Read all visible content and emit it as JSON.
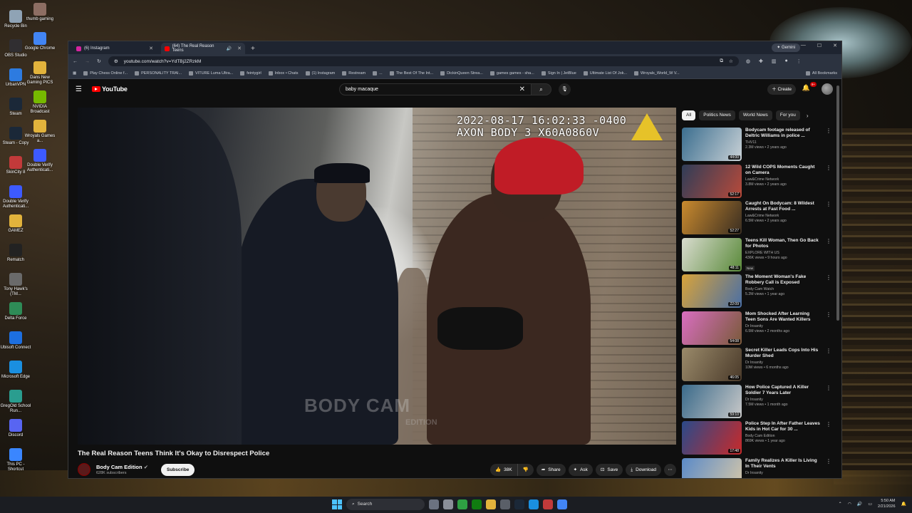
{
  "desktop": {
    "icons": [
      {
        "label": "Recycle Bin",
        "color": "#8fa3b5"
      },
      {
        "label": "OBS Studio",
        "color": "#302e31"
      },
      {
        "label": "UrbanVPN",
        "color": "#2d7be0"
      },
      {
        "label": "Steam",
        "color": "#1b2838"
      },
      {
        "label": "Steam - Copy",
        "color": "#1b2838"
      },
      {
        "label": "SkinCity 8",
        "color": "#c23a3a"
      },
      {
        "label": "Double Verify Authenticati...",
        "color": "#3d5afe"
      },
      {
        "label": "GAMEZ",
        "color": "#e2b33c"
      },
      {
        "label": "Rematch",
        "color": "#222"
      },
      {
        "label": "Tony Hawk's (TM...",
        "color": "#6a6a6a"
      },
      {
        "label": "Delta Force",
        "color": "#2e8b57"
      },
      {
        "label": "Ubisoft Connect",
        "color": "#1d6fe0"
      },
      {
        "label": "Microsoft Edge",
        "color": "#1a8fe0"
      },
      {
        "label": "GregOld School Run...",
        "color": "#2a9d8f"
      },
      {
        "label": "Discord",
        "color": "#5865f2"
      },
      {
        "label": "This PC - Shortcut",
        "color": "#3a86ff"
      }
    ],
    "icons_col2": [
      {
        "label": "thumb gaming",
        "color": "#8d6e63"
      },
      {
        "label": "Google Chrome",
        "color": "#4285f4"
      },
      {
        "label": "Dans New Gaming PICS",
        "color": "#e2b33c"
      },
      {
        "label": "NVIDIA Broadcast",
        "color": "#76b900"
      },
      {
        "label": "Wroyals Games a...",
        "color": "#e2b33c"
      },
      {
        "label": "Double Verify Authenticati...",
        "color": "#3d5afe"
      }
    ]
  },
  "browser": {
    "tabs": [
      {
        "label": "(6) Instagram",
        "fav_color": "#d6249f",
        "active": false
      },
      {
        "label": "(64) The Real Reason Teens",
        "fav_color": "#ff0000",
        "active": true
      }
    ],
    "new_tab": "+",
    "gemini_label": "Gemini",
    "url": "youtube.com/watch?v=YdTBj2ZRzkM",
    "bookmarks": [
      "Play Chess Online f...",
      "PERSONALITY TRAI...",
      "VITURE Luma Ultra...",
      "feintygirl",
      "Inbox • Chats",
      "(1) Instagram",
      "Restream",
      "...",
      "The Best Of The Int...",
      "DickinQueen Strea...",
      "games games - sha...",
      "Sign In | JetBlue",
      "Ultimate List Of Jok...",
      "Wroyals_World_W V...",
      "All Bookmarks"
    ]
  },
  "youtube": {
    "logo_text": "YouTube",
    "search_value": "baby macaque",
    "create_label": "Create",
    "notif_badge": "9+",
    "video": {
      "timestamp_line1": "2022-08-17 16:02:33 -0400",
      "timestamp_line2": "AXON BODY 3 X60A0860V",
      "watermark": "BODY CAM",
      "watermark_sub": "EDITION",
      "title": "The Real Reason Teens Think It's Okay to Disrespect Police",
      "channel": "Body Cam Edition",
      "subscribers": "628K subscribers",
      "subscribe_label": "Subscribe",
      "likes": "38K",
      "share_label": "Share",
      "ask_label": "Ask",
      "save_label": "Save",
      "download_label": "Download"
    },
    "chips": [
      "All",
      "Politics News",
      "World News",
      "For you"
    ],
    "recommendations": [
      {
        "title": "Bodycam footage released of Deltric Williams in police ...",
        "channel": "THV11",
        "views": "2.3M views • 2 years ago",
        "duration": "44:00",
        "colors": [
          "#3b6e8f",
          "#c9d1d6"
        ]
      },
      {
        "title": "12 Wild COPS Moments Caught on Camera",
        "channel": "Law&Crime Network",
        "views": "3.8M views • 2 years ago",
        "duration": "52:17",
        "colors": [
          "#2f3d58",
          "#b84a3a"
        ]
      },
      {
        "title": "Caught On Bodycam: 8 Wildest Arrests at Fast Food ...",
        "channel": "Law&Crime Network",
        "views": "6.5M views • 2 years ago",
        "duration": "52:27",
        "colors": [
          "#c98a2e",
          "#3a2e22"
        ]
      },
      {
        "title": "Teens Kill Woman, Then Go Back for Photos",
        "channel": "EXPLORE WITH US",
        "views": "436K views • 9 hours ago",
        "duration": "48:11",
        "badge": "New",
        "colors": [
          "#d9dccf",
          "#5a8a3a"
        ]
      },
      {
        "title": "The Moment Woman's Fake Robbery Call is Exposed",
        "channel": "Body Cam Watch",
        "views": "5.2M views • 1 year ago",
        "duration": "22:09",
        "colors": [
          "#d8a33a",
          "#4a6fa5"
        ]
      },
      {
        "title": "Mom Shocked After Learning Teen Sons Are Wanted Killers",
        "channel": "Dr Insanity",
        "views": "6.5M views • 2 months ago",
        "duration": "54:08",
        "colors": [
          "#d96ec0",
          "#7a5a3a"
        ]
      },
      {
        "title": "Secret Killer Leads Cops Into His Murder Shed",
        "channel": "Dr Insanity",
        "views": "10M views • 6 months ago",
        "duration": "46:05",
        "colors": [
          "#9a8a6a",
          "#4a3a2a"
        ]
      },
      {
        "title": "How Police Captured A Killer Soldier 7 Years Later",
        "channel": "Dr Insanity",
        "views": "7.5M views • 1 month ago",
        "duration": "59:10",
        "colors": [
          "#3a6a8a",
          "#c8c8c8"
        ]
      },
      {
        "title": "Police Step In After Father Leaves Kids in Hot Car for 30 ...",
        "channel": "Body Cam Edition",
        "views": "869K views • 1 year ago",
        "duration": "17:48",
        "colors": [
          "#2a4a8a",
          "#c82a2a"
        ]
      },
      {
        "title": "Family Realizes A Killer Is Living In Their Vents",
        "channel": "Dr Insanity",
        "views": "",
        "duration": "",
        "colors": [
          "#5a8ac8",
          "#d8c8a8"
        ]
      }
    ]
  },
  "taskbar": {
    "search_label": "Search",
    "time": "5:50 AM",
    "date": "2/21/2026"
  }
}
